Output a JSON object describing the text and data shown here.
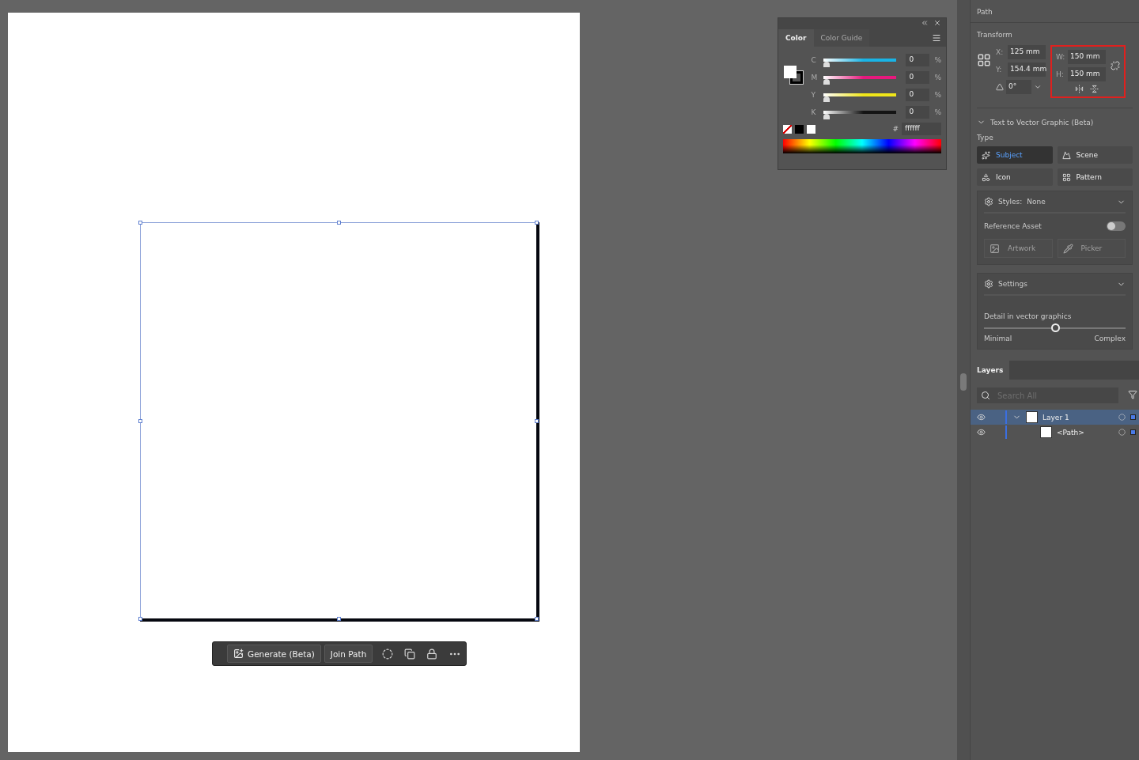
{
  "color_panel": {
    "tabs": [
      {
        "label": "Color",
        "selected": true
      },
      {
        "label": "Color Guide",
        "selected": false
      }
    ],
    "channels": [
      {
        "label": "C",
        "value": "0",
        "unit": "%",
        "color": "#19b4e6",
        "level": 0
      },
      {
        "label": "M",
        "value": "0",
        "unit": "%",
        "color": "#e6197d",
        "level": 0
      },
      {
        "label": "Y",
        "value": "0",
        "unit": "%",
        "color": "#f0e619",
        "level": 0
      },
      {
        "label": "K",
        "value": "0",
        "unit": "%",
        "color": "#141414",
        "level": 0
      }
    ],
    "hex_sign": "#",
    "hex": "ffffff"
  },
  "properties": {
    "title": "Path",
    "transform_title": "Transform",
    "fields": [
      {
        "label": "X:",
        "value": "125 mm"
      },
      {
        "label": "Y:",
        "value": "154.4 mm"
      }
    ],
    "angle": "0°",
    "size_fields": [
      {
        "label": "W:",
        "value": "150 mm"
      },
      {
        "label": "H:",
        "value": "150 mm"
      }
    ]
  },
  "text_to_vector": {
    "title": "Text to Vector Graphic (Beta)",
    "expanded": true,
    "type_label": "Type",
    "types": [
      {
        "label": "Subject",
        "selected": true
      },
      {
        "label": "Scene",
        "selected": false
      },
      {
        "label": "Icon",
        "selected": false
      },
      {
        "label": "Pattern",
        "selected": false
      }
    ],
    "styles_label": "Styles:",
    "styles_value": "None",
    "reference_label": "Reference Asset",
    "reference_on": false,
    "asset_buttons": [
      {
        "label": "Artwork",
        "disabled": true
      },
      {
        "label": "Picker",
        "disabled": true
      }
    ],
    "settings_title": "Settings",
    "detail_label": "Detail in vector graphics",
    "detail": {
      "level": 0.5
    },
    "min_label": "Minimal",
    "max_label": "Complex"
  },
  "layers": {
    "tab": "Layers",
    "search": {
      "placeholder": "Search All"
    },
    "rows": [
      {
        "name": "Layer 1",
        "selected": true,
        "visible": true,
        "expanded": true,
        "children": [
          {
            "name": "<Path>",
            "selected": false,
            "visible": true
          }
        ]
      }
    ]
  },
  "toolbar": {
    "buttons": [
      "Generate (Beta)",
      "Join Path"
    ]
  }
}
